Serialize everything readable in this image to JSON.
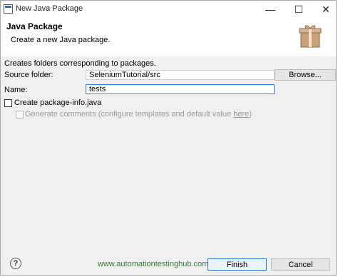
{
  "titlebar": {
    "title": "New Java Package",
    "minimize": "—",
    "maximize": "☐",
    "close": "✕"
  },
  "header": {
    "title": "Java Package",
    "description": "Create a new Java package."
  },
  "form": {
    "info": "Creates folders corresponding to packages.",
    "source_folder_label": "Source folder:",
    "source_folder_value": "SeleniumTutorial/src",
    "browse_label": "Browse...",
    "name_label": "Name:",
    "name_value": "tests",
    "create_pkg_info_label": "Create package-info.java",
    "generate_comments_label": "Generate comments (configure templates and default value ",
    "generate_comments_link": "here",
    "generate_comments_suffix": ")"
  },
  "footer": {
    "help": "?",
    "watermark": "www.automationtestinghub.com",
    "finish_label": "Finish",
    "cancel_label": "Cancel"
  }
}
